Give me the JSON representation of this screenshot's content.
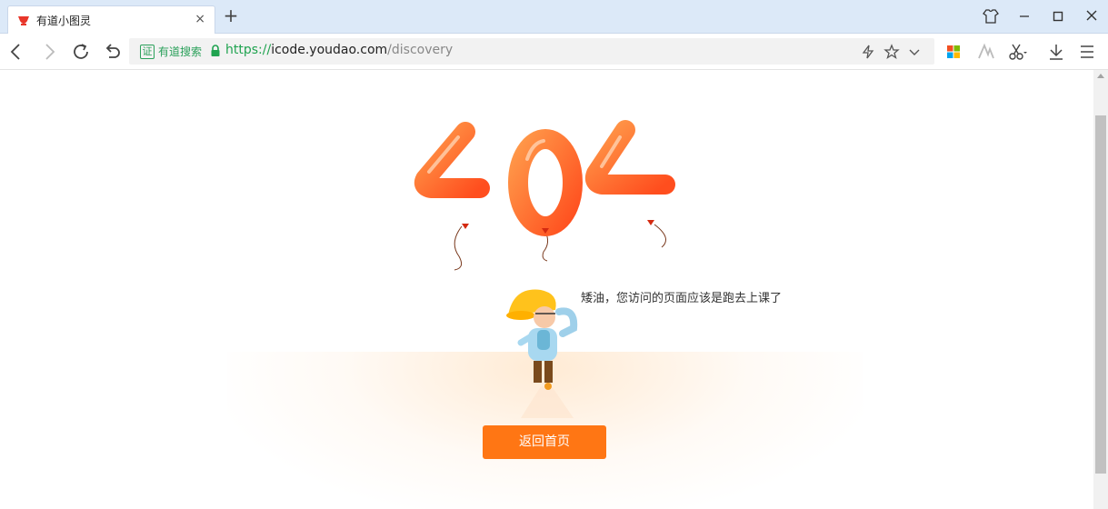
{
  "tab": {
    "title": "有道小图灵",
    "close_glyph": "×",
    "new_tab_glyph": "+"
  },
  "address_bar": {
    "verify_badge": "证",
    "verify_label": "有道搜索",
    "url_scheme": "https://",
    "url_host": "icode.youdao.com",
    "url_path": "/discovery"
  },
  "page": {
    "error_code": "404",
    "message": "矮油，您访问的页面应该是跑去上课了",
    "home_button_label": "返回首页"
  },
  "colors": {
    "accent": "#ff7614",
    "balloon": "#ff6a2a",
    "secure_green": "#1fa34f"
  }
}
